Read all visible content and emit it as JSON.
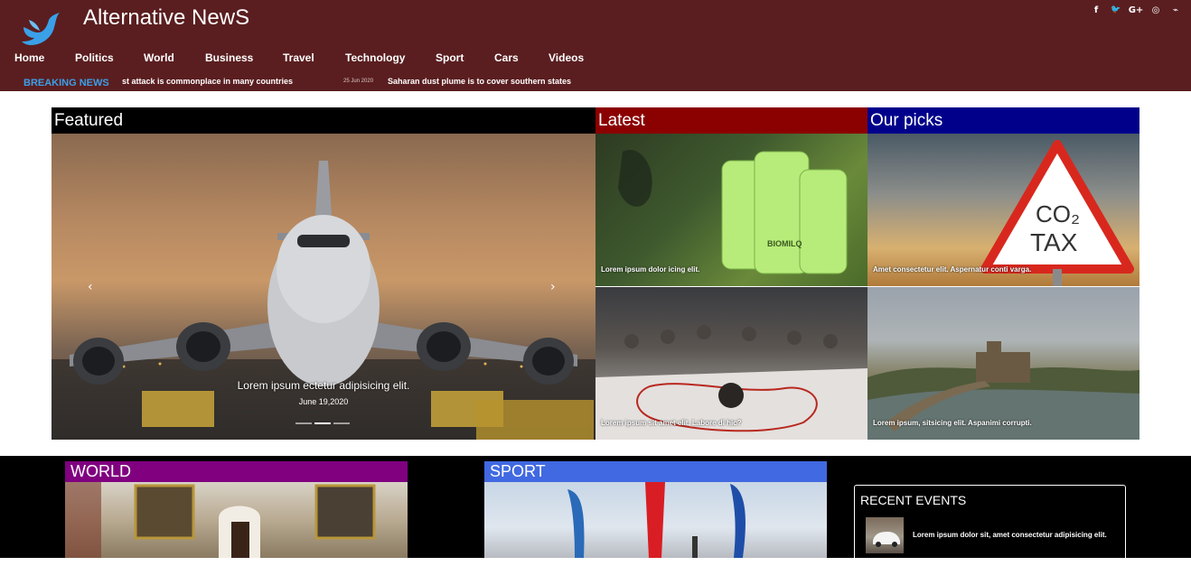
{
  "header": {
    "site_title": "Alternative NewS",
    "colors": {
      "background": "#5a1e20",
      "logo": "#3aa0e8"
    },
    "social": [
      {
        "icon": "facebook-icon",
        "glyph": "f"
      },
      {
        "icon": "twitter-icon",
        "glyph": "🐦"
      },
      {
        "icon": "google-plus-icon",
        "glyph": "G+"
      },
      {
        "icon": "instagram-icon",
        "glyph": "◎"
      },
      {
        "icon": "rss-icon",
        "glyph": "⌁"
      }
    ]
  },
  "nav": {
    "items": [
      "Home",
      "Politics",
      "World",
      "Business",
      "Travel",
      "Technology",
      "Sport",
      "Cars",
      "Videos"
    ]
  },
  "breaking": {
    "label": "BREAKING NEWS",
    "ticker_1": "st attack is commonplace in many countries",
    "ticker_2_date": "25 Jun 2020",
    "ticker_2": "Saharan dust plume is to cover southern states"
  },
  "sections": {
    "featured": "Featured",
    "latest": "Latest",
    "picks": "Our picks",
    "world": "WORLD",
    "sport": "SPORT"
  },
  "slider": {
    "caption": "Lorem ipsum ectetur adipisicing elit.",
    "date": "June 19,2020",
    "prev_glyph": "‹",
    "next_glyph": "›",
    "slide_count": 3,
    "active_slide": 2
  },
  "tiles": {
    "latest_1": "Lorem ipsum dolor icing elit.",
    "picks_1": "Amet consectetur elit. Aspernatur conti varga.",
    "latest_2": "Lorem ipsum sit amet elit. Labore di hic?",
    "picks_2": "Lorem ipsum, sitsicing elit. Aspanimi corrupti."
  },
  "tile_graphics": {
    "bottle_brand": "BIOMILQ",
    "sign_line_1": "CO₂",
    "sign_line_2": "TAX"
  },
  "events": {
    "title": "RECENT EVENTS",
    "item_1": "Lorem ipsum dolor sit, amet consectetur adipisicing elit."
  }
}
